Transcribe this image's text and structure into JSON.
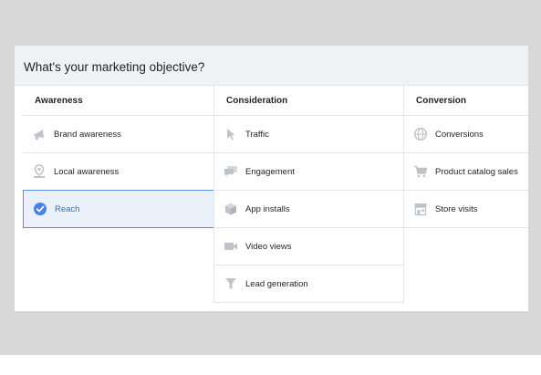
{
  "title": "What's your marketing objective?",
  "columns": [
    {
      "heading": "Awareness",
      "items": [
        {
          "label": "Brand awareness",
          "icon": "megaphone-icon"
        },
        {
          "label": "Local awareness",
          "icon": "map-pin-icon"
        },
        {
          "label": "Reach",
          "icon": "check-circle-icon",
          "selected": true
        }
      ]
    },
    {
      "heading": "Consideration",
      "items": [
        {
          "label": "Traffic",
          "icon": "cursor-icon"
        },
        {
          "label": "Engagement",
          "icon": "chat-bubbles-icon"
        },
        {
          "label": "App installs",
          "icon": "box-icon"
        },
        {
          "label": "Video views",
          "icon": "video-camera-icon"
        },
        {
          "label": "Lead generation",
          "icon": "funnel-icon"
        }
      ]
    },
    {
      "heading": "Conversion",
      "items": [
        {
          "label": "Conversions",
          "icon": "globe-icon"
        },
        {
          "label": "Product catalog sales",
          "icon": "shopping-cart-icon"
        },
        {
          "label": "Store visits",
          "icon": "store-icon"
        }
      ]
    }
  ],
  "colors": {
    "selected_bg": "#eaf1fb",
    "selected_border": "#5b8ce6",
    "selected_text": "#4267b2",
    "icon_gray": "#bec3c9",
    "page_bg": "#d8d8d8"
  }
}
